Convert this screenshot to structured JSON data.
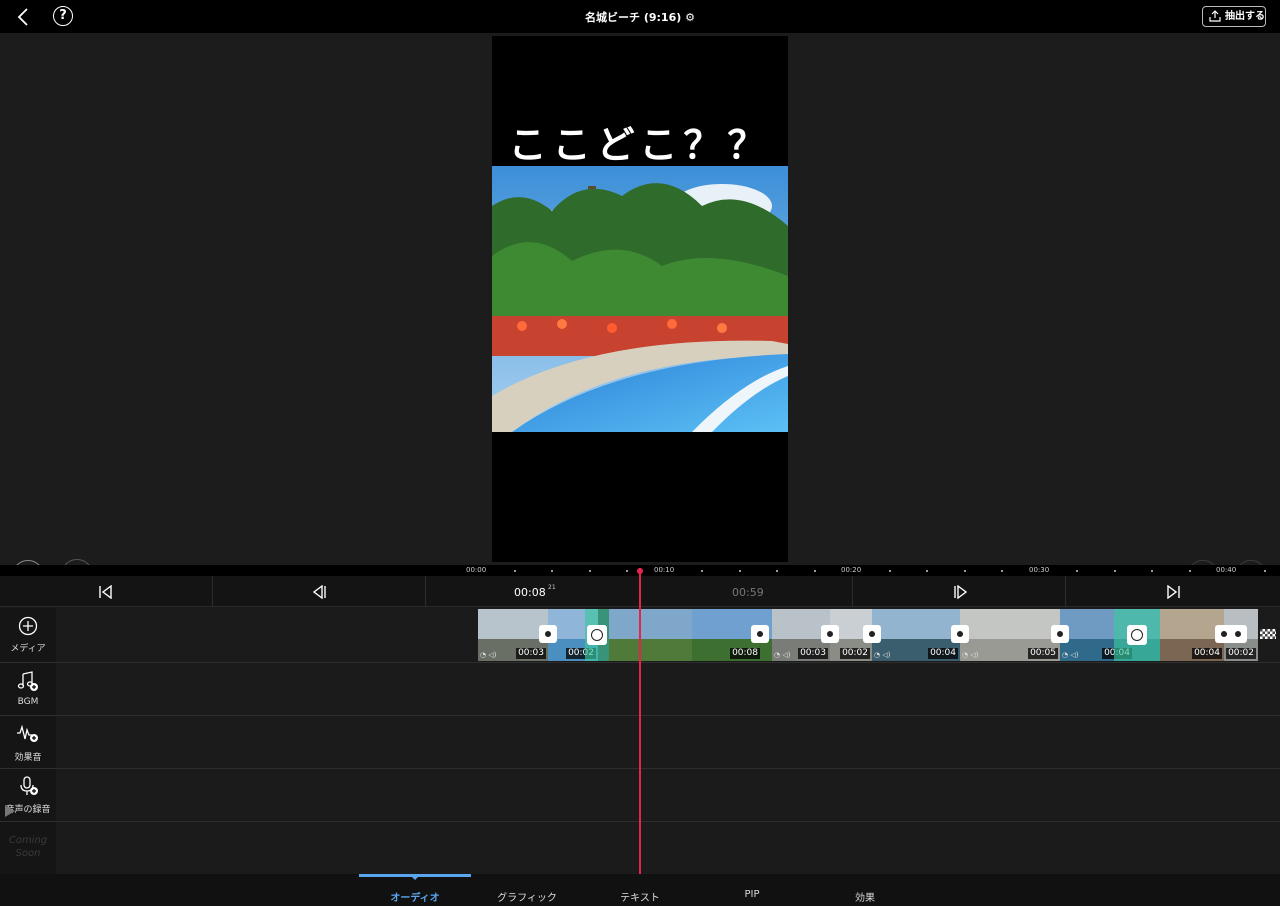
{
  "header": {
    "title": "名城ビーチ (9:16)",
    "settings_icon": "gear-icon",
    "export_label": "抽出する",
    "back_icon": "chevron-left-icon",
    "help_icon": "question-circle-icon"
  },
  "preview": {
    "caption": "ここどこ？？",
    "image": "tropical-pool-palm-trees"
  },
  "controls": {
    "play_icon": "play-icon",
    "fullscreen_icon": "fullscreen-icon",
    "undo_icon": "undo-icon",
    "redo_icon": "redo-icon"
  },
  "ruler": {
    "labels": [
      "00:00",
      "00:10",
      "00:20",
      "00:30",
      "00:40"
    ]
  },
  "transport": {
    "current_time": "00:08",
    "current_frame": "21",
    "total_time": "00:59"
  },
  "tracks": {
    "media_label": "メディア",
    "bgm_label": "BGM",
    "sfx_label": "効果音",
    "voice_label": "音声の録音",
    "coming_soon": "Coming Soon"
  },
  "clips": [
    "00:03",
    "00:02",
    "00:08",
    "00:03",
    "00:02",
    "00:04",
    "00:05",
    "00:04",
    "00:04",
    "00:02"
  ],
  "tabs": [
    "オーディオ",
    "グラフィック",
    "テキスト",
    "PIP",
    "効果"
  ],
  "colors": {
    "accent": "#5aa6f0",
    "playhead": "#e8234b",
    "teal": "#3cc8a0"
  }
}
